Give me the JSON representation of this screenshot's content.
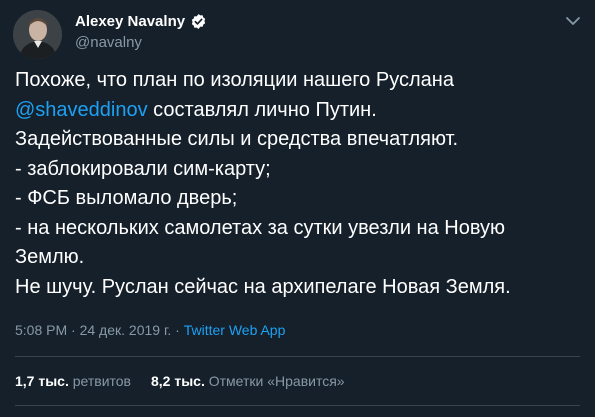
{
  "author": {
    "display_name": "Alexey Navalny",
    "handle": "@navalny",
    "verified": true,
    "avatar_icon": "person-avatar"
  },
  "menu_icon": "chevron-down-icon",
  "body": {
    "line1": "Похоже, что план по изоляции нашего Руслана",
    "mention": "@shaveddinov",
    "line2_rest": " составлял лично Путин.",
    "line3": "Задействованные силы и средства впечатляют.",
    "line4": "- заблокировали сим-карту;",
    "line5": "- ФСБ выломало дверь;",
    "line6": "- на нескольких самолетах за сутки увезли на Новую",
    "line7": "Землю.",
    "line8": "Не шучу. Руслан сейчас на архипелаге Новая Земля."
  },
  "meta": {
    "time": "5:08 PM",
    "separator1": " · ",
    "date": "24 дек. 2019 г.",
    "separator2": " · ",
    "source": "Twitter Web App"
  },
  "stats": {
    "retweets_count": "1,7 тыс.",
    "retweets_label": "ретвитов",
    "likes_count": "8,2 тыс.",
    "likes_label": "Отметки «Нравится»"
  },
  "colors": {
    "background": "#15202b",
    "text": "#ffffff",
    "secondary": "#8899a6",
    "link": "#1da1f2",
    "divider": "#38444d"
  }
}
